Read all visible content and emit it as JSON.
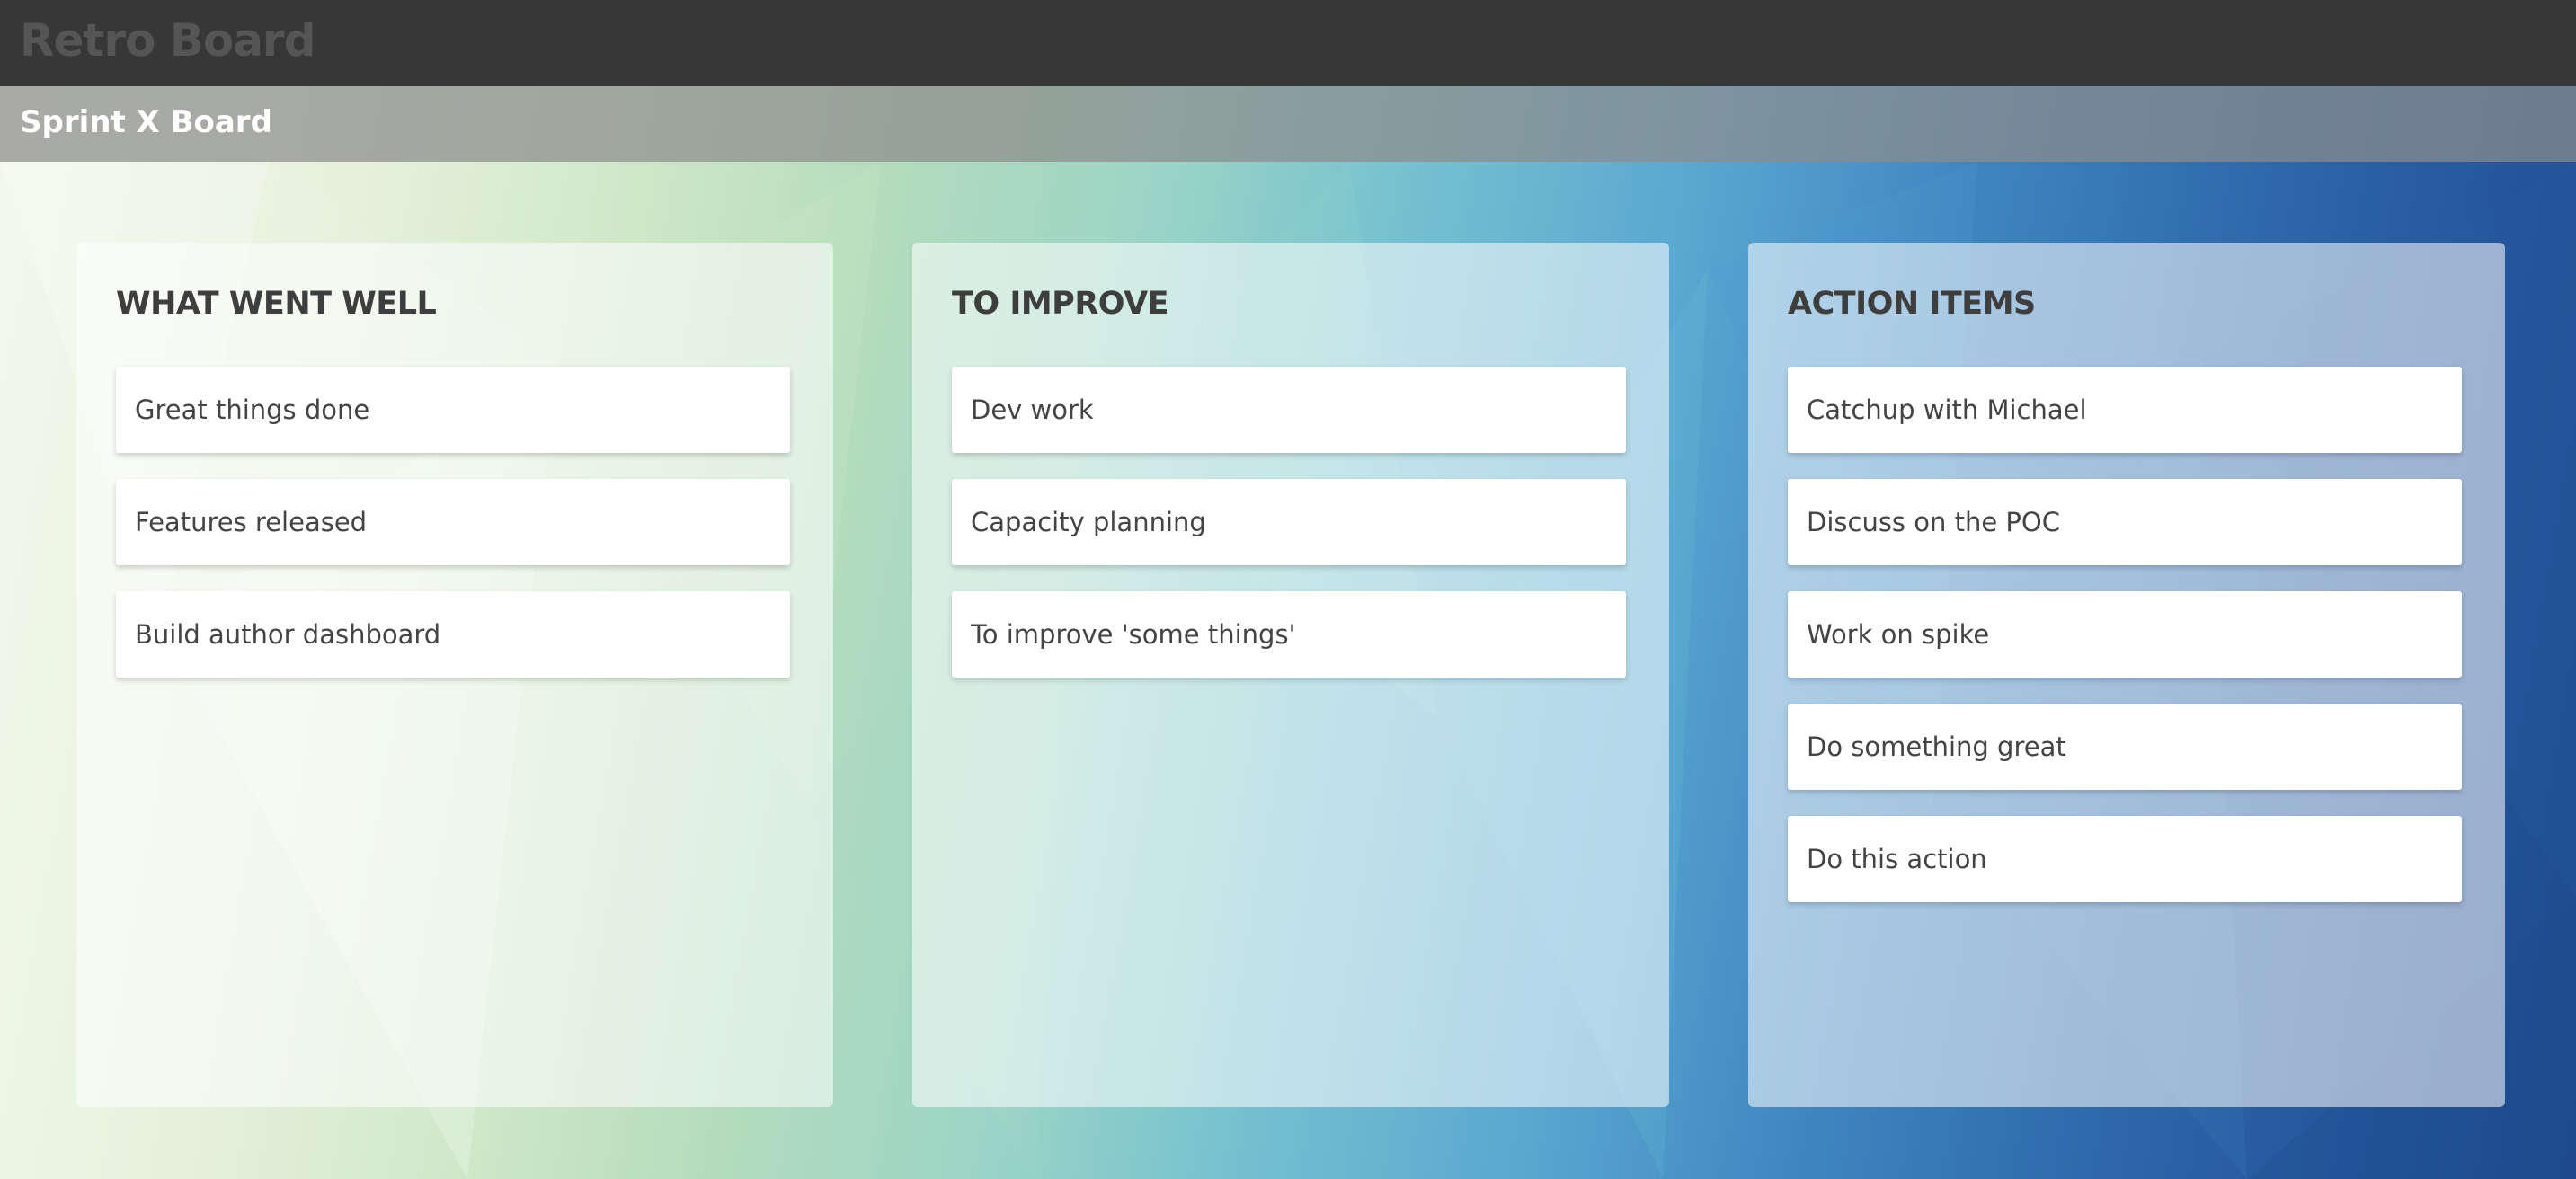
{
  "app": {
    "title": "Retro Board"
  },
  "board": {
    "title": "Sprint X Board"
  },
  "columns": [
    {
      "title": "WHAT WENT WELL",
      "cards": [
        "Great things done",
        "Features released",
        "Build author dashboard"
      ]
    },
    {
      "title": "TO IMPROVE",
      "cards": [
        "Dev work",
        "Capacity planning",
        "To improve 'some things'"
      ]
    },
    {
      "title": "ACTION ITEMS",
      "cards": [
        "Catchup with Michael",
        "Discuss on the POC",
        "Work on spike",
        "Do something great",
        "Do this action"
      ]
    }
  ]
}
